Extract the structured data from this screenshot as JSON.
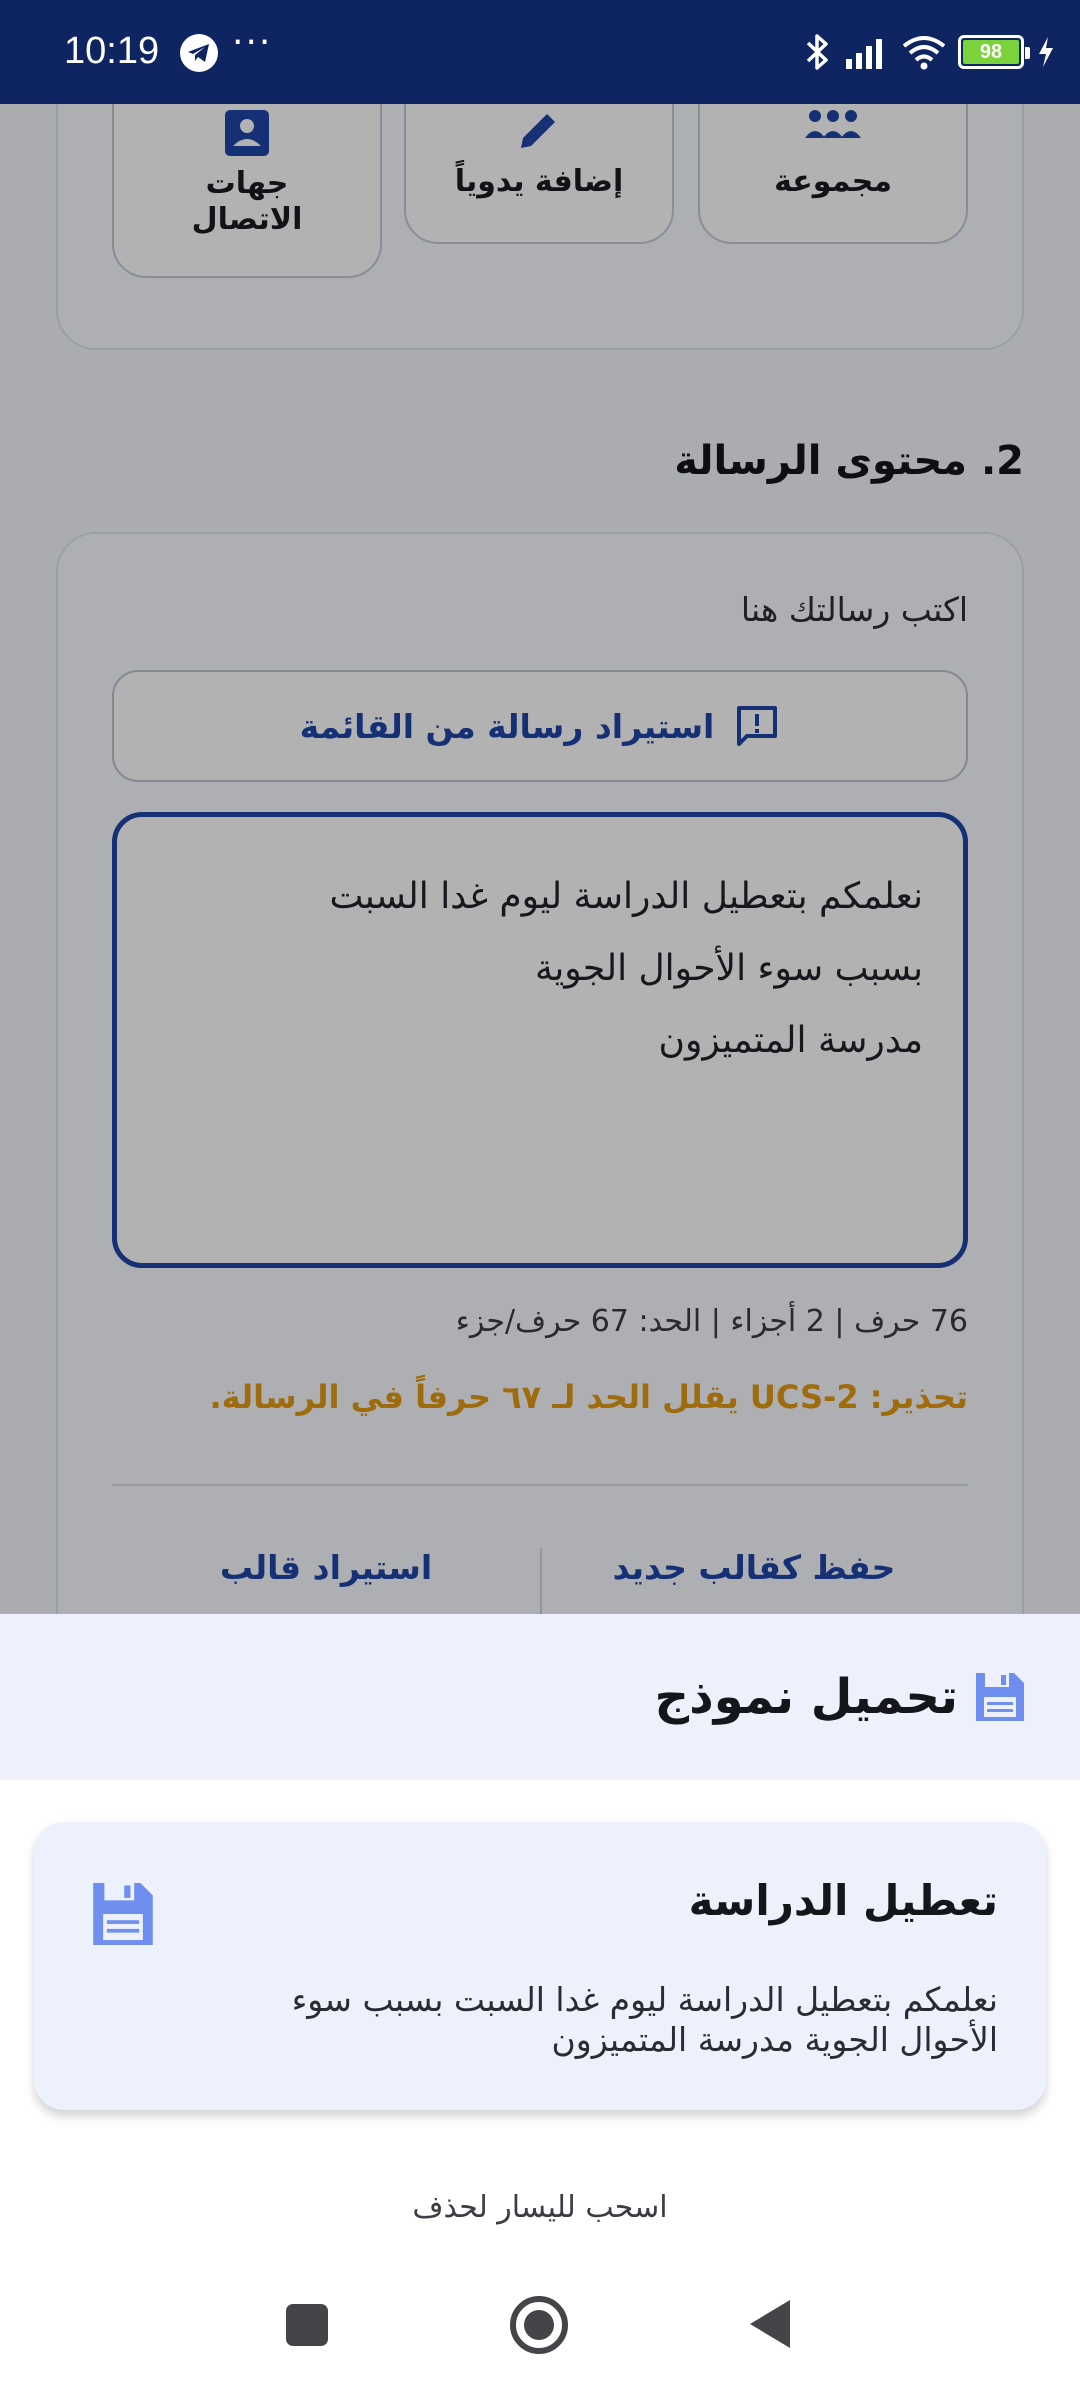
{
  "status_bar": {
    "time": "10:19",
    "dots": "···",
    "battery": "98",
    "icons": [
      "telegram-icon",
      "bluetooth-icon",
      "signal-icon",
      "wifi-icon",
      "battery-icon",
      "charging-icon"
    ]
  },
  "recipients": {
    "group_label": "مجموعة",
    "manual_label": "إضافة يدوياً",
    "contacts_label": "جهات الاتصال"
  },
  "message": {
    "section_title": "2. محتوى الرسالة",
    "hint": "اكتب رسالتك هنا",
    "import_button": "استيراد رسالة من القائمة",
    "text": "نعلمكم بتعطيل الدراسة ليوم غدا السبت\nبسبب سوء الأحوال الجوية\nمدرسة المتميزون",
    "counter": "76 حرف | 2 أجزاء | الحد: 67 حرف/جزء",
    "warning": "تحذير: UCS-2 يقلل الحد لـ ٦٧ حرفاً في الرسالة.",
    "save_template": "حفظ كقالب جديد",
    "import_template": "استيراد قالب"
  },
  "sheet": {
    "title": "تحميل نموذج",
    "templates": [
      {
        "title": "تعطيل الدراسة",
        "body": "نعلمكم بتعطيل الدراسة ليوم غدا السبت بسبب سوء الأحوال الجوية مدرسة المتميزون"
      }
    ],
    "swipe_hint": "اسحب لليسار لحذف"
  },
  "colors": {
    "accent": "#1f45a8",
    "warning": "#e39a13",
    "status_bar": "#0e2561",
    "save_icon": "#6f8ff0"
  }
}
